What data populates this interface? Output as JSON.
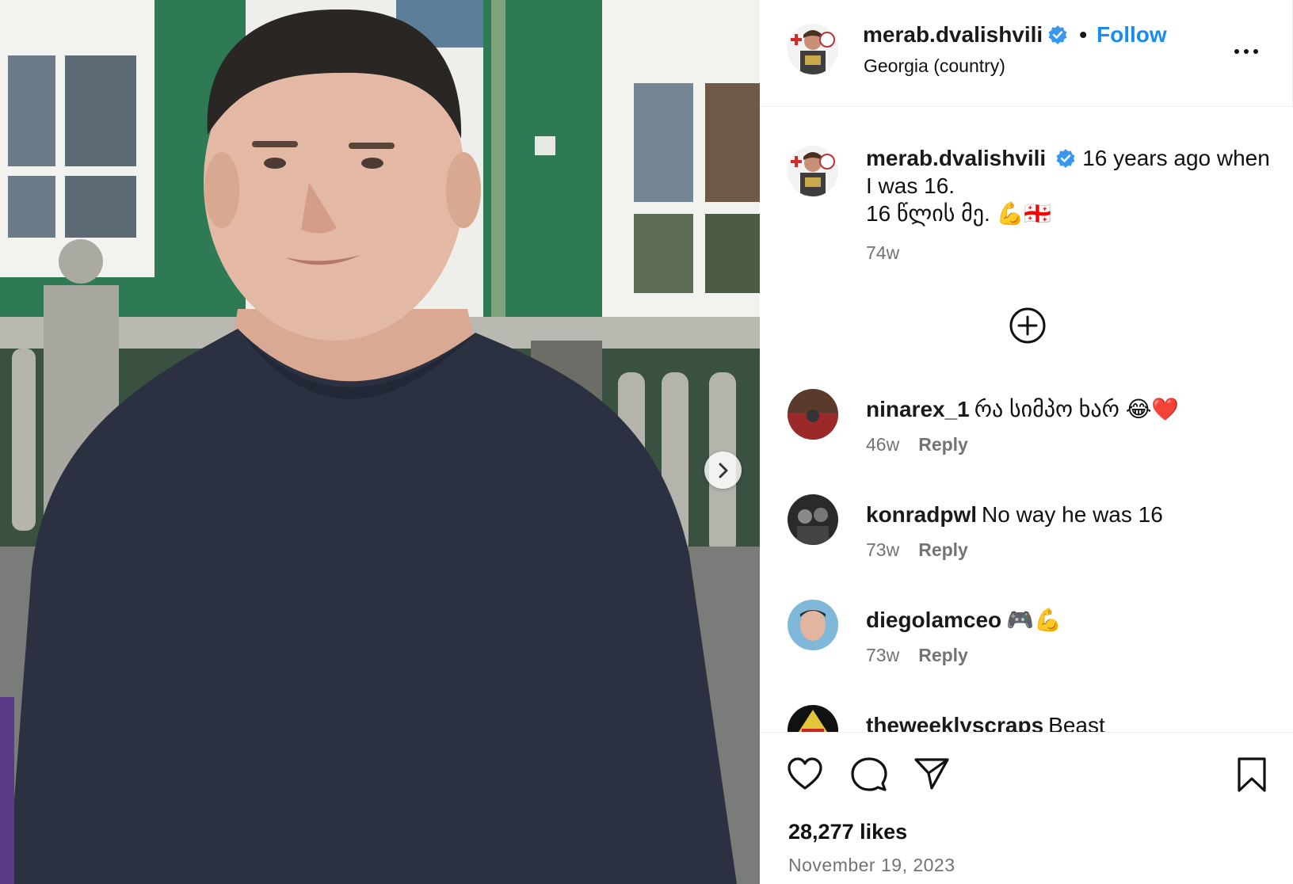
{
  "post": {
    "author": "merab.dvalishvili",
    "location": "Georgia (country)",
    "follow_label": "Follow",
    "separator": "•",
    "caption_line1": "16 years ago when I was 16.",
    "caption_line2": "16 წლის მე. 💪🇬🇪",
    "caption_age": "74w",
    "likes": "28,277 likes",
    "date": "November 19, 2023"
  },
  "comments": [
    {
      "user": "ninarex_1",
      "text": "რა სიმპო ხარ 😂❤️",
      "age": "46w",
      "reply": "Reply"
    },
    {
      "user": "konradpwl",
      "text": "No way he was 16",
      "age": "73w",
      "reply": "Reply"
    },
    {
      "user": "diegolamceo",
      "text": "🎮💪",
      "age": "73w",
      "reply": "Reply"
    },
    {
      "user": "theweeklyscraps",
      "text": "Beast",
      "age": "",
      "reply": ""
    }
  ],
  "icons": {
    "verified": "verified-badge-icon",
    "more": "more-options-icon",
    "add_comment": "add-circle-icon",
    "like": "heart-icon",
    "comment": "comment-icon",
    "share": "share-icon",
    "save": "bookmark-icon",
    "next": "chevron-right-icon"
  },
  "colors": {
    "accent": "#1a8cf0",
    "verified": "#3897f0",
    "muted": "#737373"
  }
}
